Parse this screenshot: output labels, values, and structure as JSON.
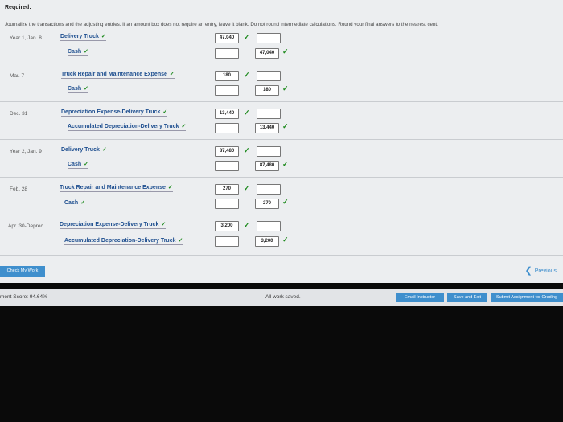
{
  "header": {
    "required": "Required:",
    "instructions": "Journalize the transactions and the adjusting entries. If an amount box does not require an entry, leave it blank. Do not round intermediate calculations. Round your final answers to the nearest cent."
  },
  "entries": [
    {
      "date": "Year 1, Jan. 8",
      "debit_account": "Delivery Truck",
      "credit_account": "Cash",
      "debit_amount": "47,040",
      "credit_amount": "47,040"
    },
    {
      "date": "Mar. 7",
      "debit_account": "Truck Repair and Maintenance Expense",
      "credit_account": "Cash",
      "debit_amount": "180",
      "credit_amount": "180"
    },
    {
      "date": "Dec. 31",
      "debit_account": "Depreciation Expense-Delivery Truck",
      "credit_account": "Accumulated Depreciation-Delivery Truck",
      "debit_amount": "13,440",
      "credit_amount": "13,440"
    },
    {
      "date": "Year 2, Jan. 9",
      "debit_account": "Delivery Truck",
      "credit_account": "Cash",
      "debit_amount": "87,480",
      "credit_amount": "87,480"
    },
    {
      "date": "Feb. 28",
      "debit_account": "Truck Repair and Maintenance Expense",
      "credit_account": "Cash",
      "debit_amount": "270",
      "credit_amount": "270"
    },
    {
      "date": "Apr. 30-Deprec.",
      "debit_account": "Depreciation Expense-Delivery Truck",
      "credit_account": "Accumulated Depreciation-Delivery Truck",
      "debit_amount": "3,200",
      "credit_amount": "3,200"
    }
  ],
  "check_mark": "✓",
  "buttons": {
    "check_my_work": "Check My Work",
    "previous": "Previous",
    "email_instructor": "Email Instructor",
    "save_and_exit": "Save and Exit",
    "submit": "Submit Assignment for Grading"
  },
  "footer": {
    "score": "ment Score: 94.64%",
    "saved": "All work saved."
  },
  "colors": {
    "accent": "#3f8fcd",
    "correct": "#1d8a1d",
    "account_text": "#1d4e8f"
  }
}
